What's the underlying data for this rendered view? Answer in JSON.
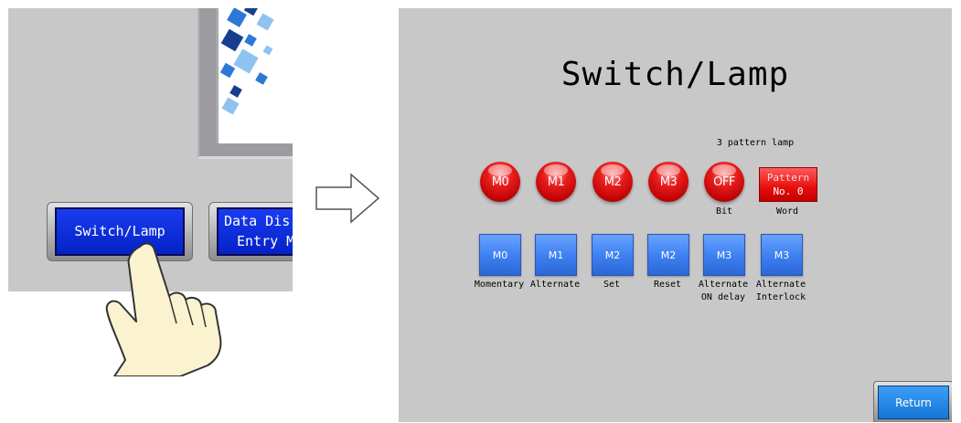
{
  "left_screen": {
    "switch_lamp_button": "Switch/Lamp",
    "data_button_line1": "Data Dis",
    "data_button_line2": "Entry M"
  },
  "right_screen": {
    "title": "Switch/Lamp",
    "pattern_lamp_heading": "3 pattern lamp",
    "lamps": [
      {
        "label": "M0"
      },
      {
        "label": "M1"
      },
      {
        "label": "M2"
      },
      {
        "label": "M3"
      },
      {
        "label": "OFF",
        "caption": "Bit"
      }
    ],
    "pattern_display": {
      "line1": "Pattern",
      "line2": "No. 0",
      "caption": "Word"
    },
    "switches": [
      {
        "label": "M0",
        "caption": "Momentary"
      },
      {
        "label": "M1",
        "caption": "Alternate"
      },
      {
        "label": "M2",
        "caption": "Set"
      },
      {
        "label": "M2",
        "caption": "Reset"
      },
      {
        "label": "M3",
        "caption": "Alternate\nON delay"
      },
      {
        "label": "M3",
        "caption": "Alternate\nInterlock"
      }
    ],
    "return_button": "Return"
  },
  "colors": {
    "panel_bg": "#c8c8c8",
    "lamp_red": "#e81d1d",
    "switch_blue": "#3c7ff0",
    "nav_button_blue": "#0522c4"
  },
  "icons": [
    "hand-pointer-icon",
    "right-arrow-icon"
  ]
}
